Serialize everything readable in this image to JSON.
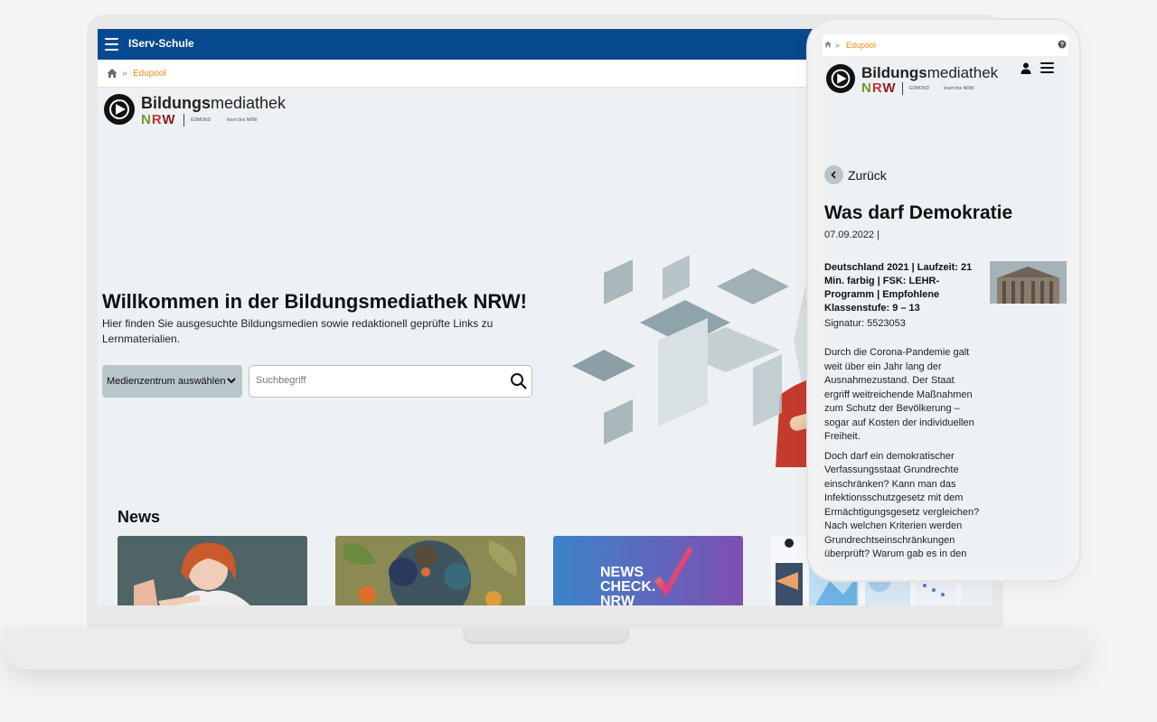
{
  "laptop": {
    "app_title": "IServ-Schule",
    "breadcrumb": "Edupool",
    "breadcrumb_sep": "»",
    "logo": {
      "word_bold": "Bildungs",
      "word_light": "mediathek",
      "region": "NRW",
      "partner1": "EDMOND",
      "partner2": "learn:line NRW"
    },
    "hero": {
      "title": "Willkommen in der Bildungsmediathek NRW!",
      "subtitle": "Hier finden Sie ausgesuchte Bildungsmedien sowie redaktionell geprüfte Links zu Lernmaterialien."
    },
    "select_label": "Medienzentrum auswählen",
    "search_placeholder": "Suchbegriff",
    "news_title": "News",
    "news_cards": [
      {
        "kind": "photo-woman"
      },
      {
        "kind": "globes-illustration"
      },
      {
        "kind": "newscheck",
        "text": "NEWS CHECK. NRW"
      },
      {
        "kind": "screenshots"
      }
    ]
  },
  "phone": {
    "breadcrumb": "Edupool",
    "breadcrumb_sep": "»",
    "back_label": "Zurück",
    "title": "Was darf Demokratie",
    "date": "07.09.2022 |",
    "meta": "Deutschland 2021 | Laufzeit: 21 Min. farbig | FSK: LEHR-Programm | Empfohlene Klassenstufe: 9 – 13",
    "signature": "Signatur: 5523053",
    "paragraph1": "Durch die Corona-Pandemie galt weit über ein Jahr lang der Ausnahmezustand. Der Staat ergriff weitreichende Maßnahmen zum Schutz der Bevölkerung – sogar auf Kosten der individuellen Freiheit.",
    "paragraph2": "Doch darf ein demokratischer Verfassungsstaat Grundrechte einschränken? Kann man das Infektionsschutzgesetz mit dem Ermächtigungsgesetz vergleichen? Nach welchen Kriterien werden Grundrechtseinschränkungen überprüft? Warum gab es in den"
  },
  "colors": {
    "header_blue": "#06498e",
    "accent_orange": "#e98a14",
    "nrw_green": "#6d9a26",
    "nrw_red": "#c73232"
  },
  "icons": [
    "menu-icon",
    "home-icon",
    "chevron-down-icon",
    "search-icon",
    "user-icon",
    "help-icon",
    "back-arrow-icon"
  ]
}
